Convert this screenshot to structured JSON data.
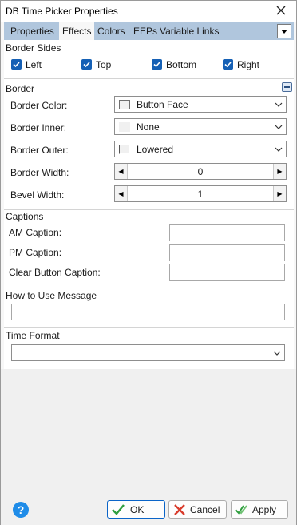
{
  "window": {
    "title": "DB Time Picker Properties"
  },
  "tabs": [
    {
      "label": "Properties"
    },
    {
      "label": "Effects"
    },
    {
      "label": "Colors"
    },
    {
      "label": "EEPs"
    },
    {
      "label": "Variable Links"
    }
  ],
  "active_tab": "Effects",
  "border_sides": {
    "title": "Border Sides",
    "left": {
      "label": "Left",
      "checked": true
    },
    "top": {
      "label": "Top",
      "checked": true
    },
    "bottom": {
      "label": "Bottom",
      "checked": true
    },
    "right": {
      "label": "Right",
      "checked": true
    }
  },
  "border": {
    "title": "Border",
    "color": {
      "label": "Border Color:",
      "value": "Button Face"
    },
    "inner": {
      "label": "Border Inner:",
      "value": "None"
    },
    "outer": {
      "label": "Border Outer:",
      "value": "Lowered"
    },
    "width": {
      "label": "Border Width:",
      "value": "0"
    },
    "bevel": {
      "label": "Bevel Width:",
      "value": "1"
    }
  },
  "captions": {
    "title": "Captions",
    "am": {
      "label": "AM Caption:",
      "value": ""
    },
    "pm": {
      "label": "PM Caption:",
      "value": ""
    },
    "clear": {
      "label": "Clear Button Caption:",
      "value": ""
    }
  },
  "how_to_use": {
    "title": "How to Use Message",
    "value": ""
  },
  "time_format": {
    "title": "Time Format",
    "value": ""
  },
  "buttons": {
    "ok": "OK",
    "cancel": "Cancel",
    "apply": "Apply",
    "help": "?"
  },
  "colors": {
    "accent": "#1560b5",
    "tabbar": "#b0c6dd",
    "help": "#1f8ce8",
    "ok_check": "#2e9e3e",
    "cancel_x": "#d83a2a"
  }
}
